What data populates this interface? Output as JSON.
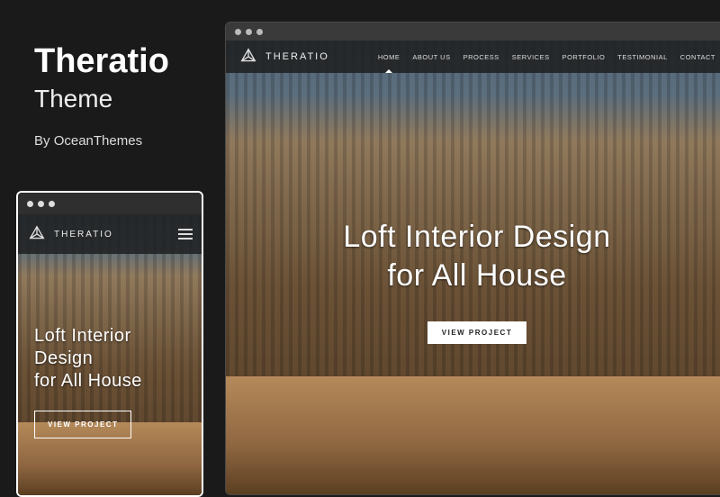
{
  "info": {
    "title": "Theratio",
    "subtitle": "Theme",
    "by_prefix": "By ",
    "author": "OceanThemes"
  },
  "site": {
    "logo_text": "THERATIO",
    "nav": [
      {
        "label": "HOME",
        "active": true
      },
      {
        "label": "ABOUT US",
        "active": false
      },
      {
        "label": "PROCESS",
        "active": false
      },
      {
        "label": "SERVICES",
        "active": false
      },
      {
        "label": "PORTFOLIO",
        "active": false
      },
      {
        "label": "TESTIMONIAL",
        "active": false
      },
      {
        "label": "CONTACT",
        "active": false
      }
    ],
    "hero": {
      "line1": "Loft Interior Design",
      "line2": "for All House",
      "cta": "VIEW PROJECT"
    }
  }
}
